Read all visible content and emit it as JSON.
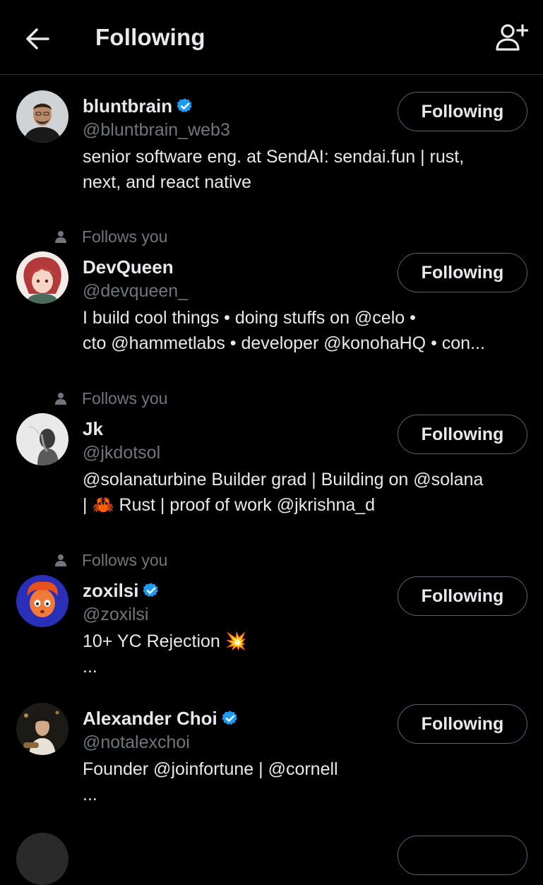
{
  "header": {
    "title": "Following",
    "back_icon": "arrow-left-icon",
    "add_icon": "add-user-icon"
  },
  "colors": {
    "background": "#000000",
    "text": "#e7e9ea",
    "secondary": "#71767b",
    "verified": "#1d9bf0",
    "border": "#2f3336"
  },
  "users": [
    {
      "name": "bluntbrain",
      "verified": true,
      "handle": "@bluntbrain_web3",
      "follows_you": false,
      "follows_you_label": "",
      "bio_lines": [
        "senior software eng. at SendAI: sendai.fun | rust,",
        "next, and react native"
      ],
      "button_label": "Following"
    },
    {
      "name": "DevQueen",
      "verified": false,
      "handle": "@devqueen_",
      "follows_you": true,
      "follows_you_label": "Follows you",
      "bio_lines": [
        "I build cool things • doing stuffs on @celo •",
        "cto @hammetlabs • developer @konohaHQ  • con..."
      ],
      "button_label": "Following"
    },
    {
      "name": "Jk",
      "verified": false,
      "handle": "@jkdotsol",
      "follows_you": true,
      "follows_you_label": "Follows you",
      "bio_lines": [
        "@solanaturbine Builder grad | Building on @solana",
        "| 🦀 Rust | proof of work @jkrishna_d"
      ],
      "button_label": "Following"
    },
    {
      "name": "zoxilsi",
      "verified": true,
      "handle": "@zoxilsi",
      "follows_you": true,
      "follows_you_label": "Follows you",
      "bio_lines": [
        "10+ YC Rejection 💥",
        "..."
      ],
      "button_label": "Following"
    },
    {
      "name": "Alexander Choi",
      "verified": true,
      "handle": "@notalexchoi",
      "follows_you": false,
      "follows_you_label": "",
      "bio_lines": [
        "Founder @joinfortune | @cornell",
        "..."
      ],
      "button_label": "Following"
    }
  ]
}
